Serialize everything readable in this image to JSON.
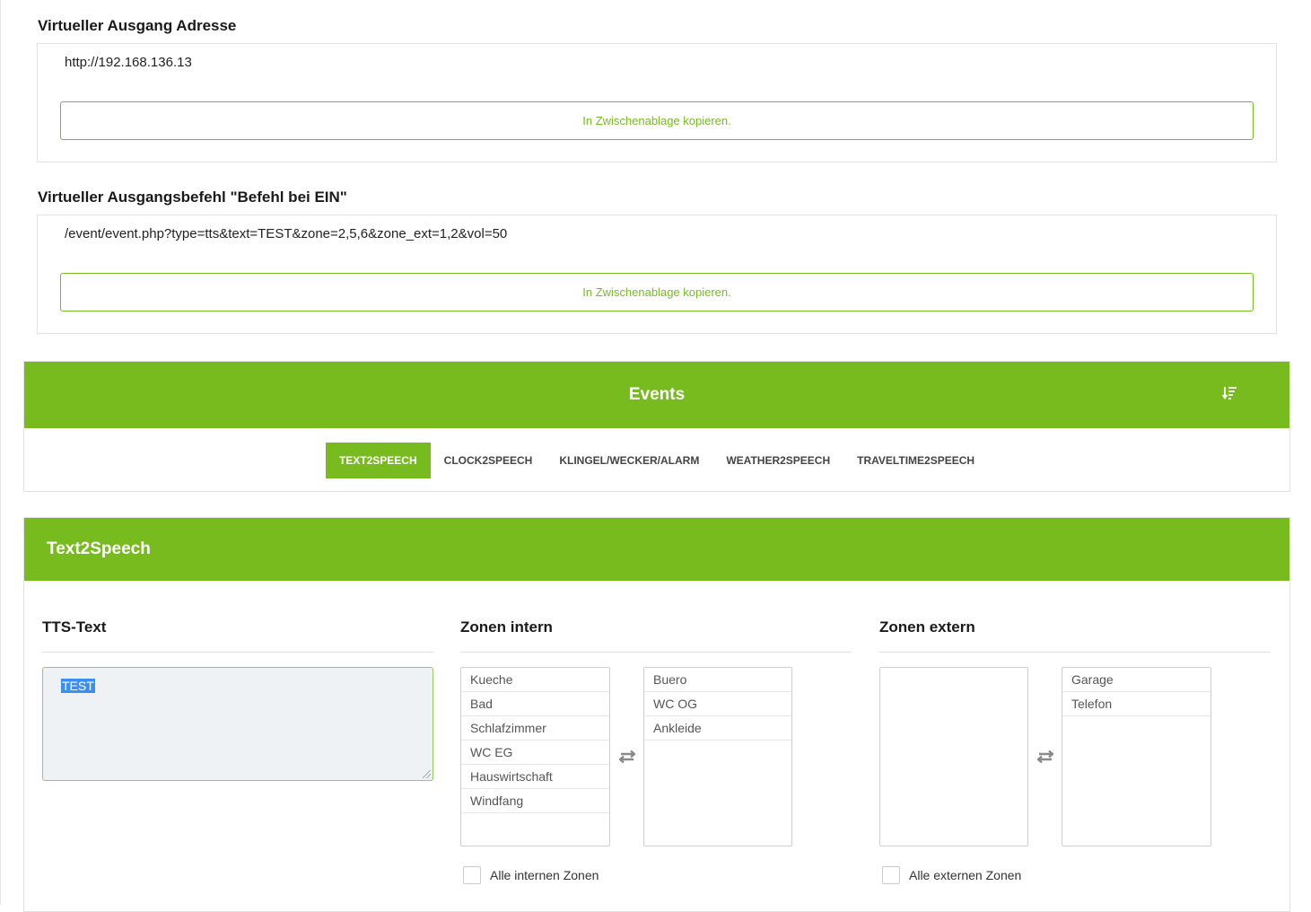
{
  "virtual_output_address": {
    "title": "Virtueller Ausgang Adresse",
    "value": "http://192.168.136.13",
    "copy_label": "In Zwischenablage kopieren."
  },
  "virtual_output_command": {
    "title": "Virtueller Ausgangsbefehl \"Befehl bei EIN\"",
    "value": "/event/event.php?type=tts&text=TEST&zone=2,5,6&zone_ext=1,2&vol=50",
    "copy_label": "In Zwischenablage kopieren."
  },
  "events": {
    "title": "Events",
    "sort_icon": "sort-descending-icon",
    "tabs": [
      {
        "label": "TEXT2SPEECH",
        "active": true
      },
      {
        "label": "CLOCK2SPEECH",
        "active": false
      },
      {
        "label": "KLINGEL/WECKER/ALARM",
        "active": false
      },
      {
        "label": "WEATHER2SPEECH",
        "active": false
      },
      {
        "label": "TRAVELTIME2SPEECH",
        "active": false
      }
    ]
  },
  "text2speech": {
    "title": "Text2Speech",
    "tts_text": {
      "label": "TTS-Text",
      "value": "TEST"
    },
    "zones_intern": {
      "label": "Zonen intern",
      "available": [
        "Kueche",
        "Bad",
        "Schlafzimmer",
        "WC EG",
        "Hauswirtschaft",
        "Windfang"
      ],
      "selected": [
        "Buero",
        "WC OG",
        "Ankleide"
      ],
      "all_label": "Alle internen Zonen"
    },
    "zones_extern": {
      "label": "Zonen extern",
      "available": [],
      "selected": [
        "Garage",
        "Telefon"
      ],
      "all_label": "Alle externen Zonen"
    }
  },
  "colors": {
    "accent": "#77bb1f",
    "button_border": "#77bb22"
  }
}
